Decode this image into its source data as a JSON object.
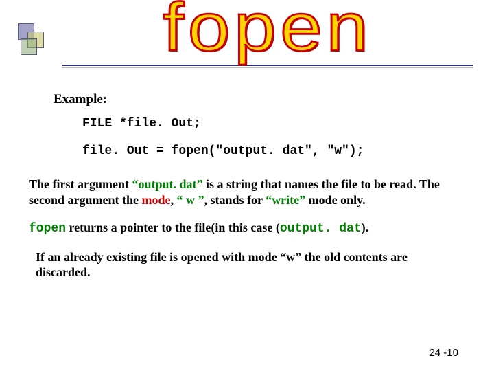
{
  "title": "fopen",
  "example_label": "Example:",
  "code": {
    "line1": "FILE *file. Out;",
    "line2": "file. Out = fopen(\"output. dat\", \"w\");"
  },
  "para1": {
    "t1": "The first argument ",
    "arg1": "“output. dat”",
    "t2": " is a string that names the file to be read. The second argument the ",
    "mode_label": "mode",
    "t3": ", ",
    "mode_value": "“ w ”",
    "t4": ", stands for ",
    "write_label": "“write”",
    "t5": " mode only."
  },
  "para2": {
    "fn": "fopen",
    "t1": " returns a pointer to the file(in this case (",
    "file": "output. dat",
    "t2": ")."
  },
  "para3": "If an already existing file is opened with mode “w” the old contents are discarded.",
  "slide_number": "24 -10"
}
